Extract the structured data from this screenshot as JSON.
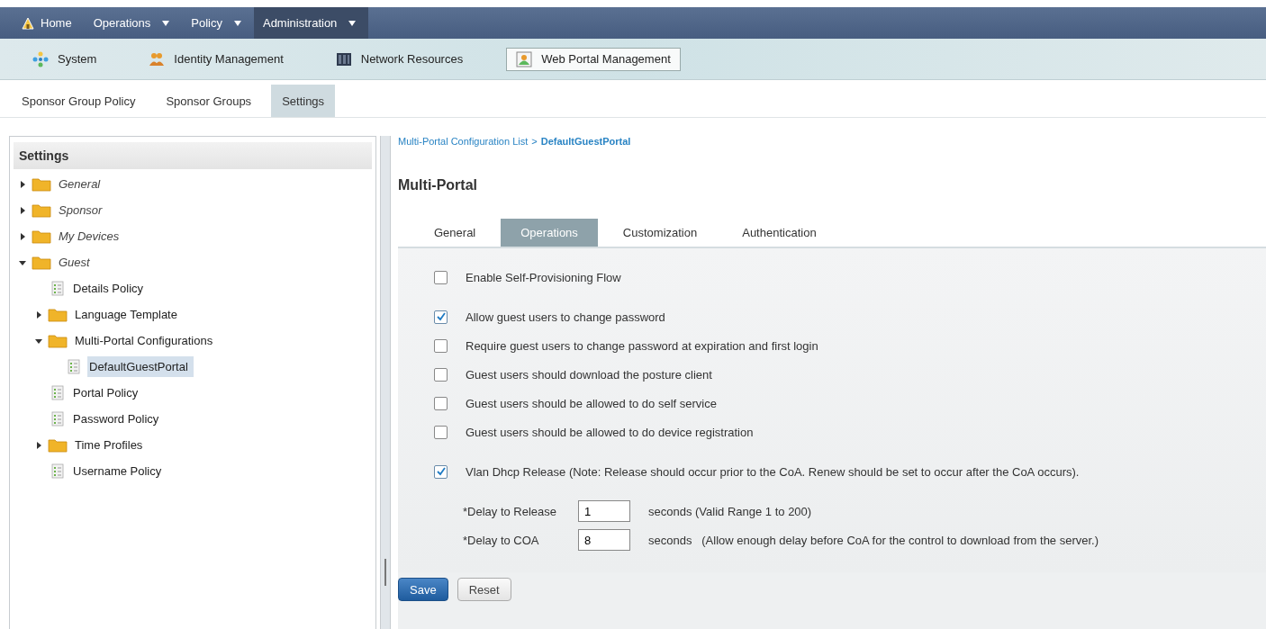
{
  "main_nav": [
    {
      "label": "Home",
      "kind": "home",
      "selected": false
    },
    {
      "label": "Operations",
      "kind": "menu",
      "selected": false
    },
    {
      "label": "Policy",
      "kind": "menu",
      "selected": false
    },
    {
      "label": "Administration",
      "kind": "menu",
      "selected": true
    }
  ],
  "sub_nav": [
    {
      "label": "System",
      "kind": "system",
      "selected": false
    },
    {
      "label": "Identity Management",
      "kind": "identity",
      "selected": false
    },
    {
      "label": "Network Resources",
      "kind": "network",
      "selected": false
    },
    {
      "label": "Web Portal Management",
      "kind": "portal",
      "selected": true
    }
  ],
  "section_tabs": [
    {
      "label": "Sponsor Group Policy",
      "selected": false
    },
    {
      "label": "Sponsor Groups",
      "selected": false
    },
    {
      "label": "Settings",
      "selected": true
    }
  ],
  "sidebar": {
    "title": "Settings",
    "tree": [
      {
        "label": "General",
        "kind": "folder",
        "expanded": false,
        "selected": false
      },
      {
        "label": "Sponsor",
        "kind": "folder",
        "expanded": false,
        "selected": false
      },
      {
        "label": "My Devices",
        "kind": "folder",
        "expanded": false,
        "selected": false
      },
      {
        "label": "Guest",
        "kind": "folder",
        "expanded": true,
        "selected": false,
        "children": [
          {
            "label": "Details Policy",
            "kind": "doc",
            "selected": false
          },
          {
            "label": "Language Template",
            "kind": "folder",
            "expanded": false,
            "selected": false
          },
          {
            "label": "Multi-Portal Configurations",
            "kind": "folder",
            "expanded": true,
            "selected": false,
            "children": [
              {
                "label": "DefaultGuestPortal",
                "kind": "doc",
                "selected": true
              }
            ]
          },
          {
            "label": "Portal Policy",
            "kind": "doc",
            "selected": false
          },
          {
            "label": "Password Policy",
            "kind": "doc",
            "selected": false
          },
          {
            "label": "Time Profiles",
            "kind": "folder",
            "expanded": false,
            "selected": false
          },
          {
            "label": "Username Policy",
            "kind": "doc",
            "selected": false
          }
        ]
      }
    ]
  },
  "breadcrumb": {
    "parent": "Multi-Portal Configuration List",
    "separator": ">",
    "current": "DefaultGuestPortal"
  },
  "page_title": "Multi-Portal",
  "tabs": [
    {
      "label": "General",
      "selected": false
    },
    {
      "label": "Operations",
      "selected": true
    },
    {
      "label": "Customization",
      "selected": false
    },
    {
      "label": "Authentication",
      "selected": false
    }
  ],
  "option_groups": [
    [
      {
        "label": "Enable Self-Provisioning Flow",
        "checked": false
      }
    ],
    [
      {
        "label": "Allow guest users to change password",
        "checked": true
      },
      {
        "label": "Require guest users to change password at expiration and first login",
        "checked": false
      },
      {
        "label": "Guest users should download the posture client",
        "checked": false
      },
      {
        "label": "Guest users should be allowed to do self service",
        "checked": false
      },
      {
        "label": "Guest users should be allowed to do device registration",
        "checked": false
      }
    ],
    [
      {
        "label": "Vlan Dhcp Release (Note: Release should occur prior to the CoA. Renew should be set to occur after the CoA occurs).",
        "checked": true
      }
    ]
  ],
  "delay_fields": [
    {
      "required": "*",
      "label": "Delay to Release",
      "value": "1",
      "hint": "seconds (Valid Range 1 to 200)"
    },
    {
      "required": "*",
      "label": "Delay to COA",
      "value": "8",
      "hint": "seconds   (Allow enough delay before CoA for the control to download from the server.)"
    }
  ],
  "buttons": [
    {
      "label": "Save",
      "kind": "primary"
    },
    {
      "label": "Reset",
      "kind": "secondary"
    }
  ]
}
